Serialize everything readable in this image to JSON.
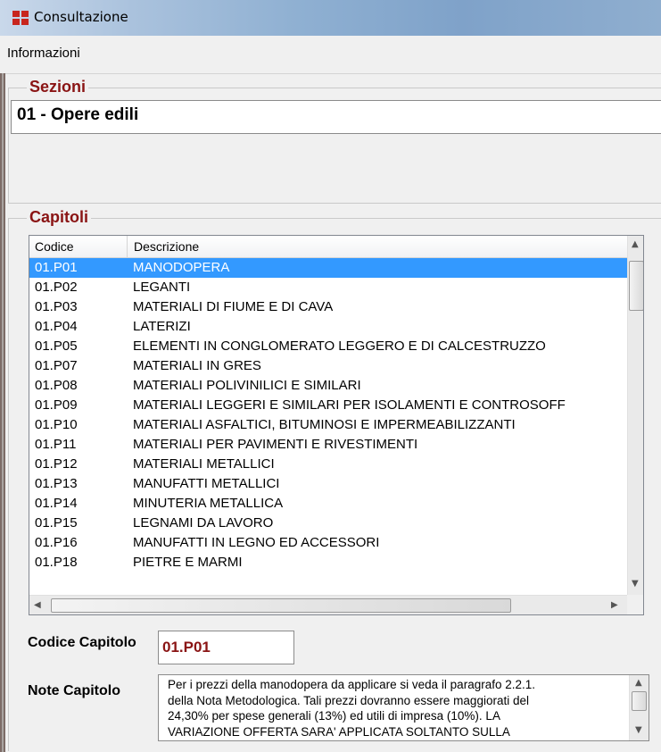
{
  "window": {
    "title": "Consultazione"
  },
  "menu": {
    "items": [
      "Informazioni"
    ]
  },
  "sezioni": {
    "label": "Sezioni",
    "value": "01 - Opere edili"
  },
  "capitoli": {
    "label": "Capitoli",
    "columns": [
      "Codice",
      "Descrizione"
    ],
    "rows": [
      {
        "code": "01.P01",
        "desc": "MANODOPERA",
        "selected": true
      },
      {
        "code": "01.P02",
        "desc": "LEGANTI"
      },
      {
        "code": "01.P03",
        "desc": "MATERIALI DI FIUME E DI CAVA"
      },
      {
        "code": "01.P04",
        "desc": "LATERIZI"
      },
      {
        "code": "01.P05",
        "desc": "ELEMENTI IN CONGLOMERATO LEGGERO E DI CALCESTRUZZO"
      },
      {
        "code": "01.P07",
        "desc": "MATERIALI IN GRES"
      },
      {
        "code": "01.P08",
        "desc": "MATERIALI POLIVINILICI E SIMILARI"
      },
      {
        "code": "01.P09",
        "desc": "MATERIALI LEGGERI E SIMILARI PER ISOLAMENTI E CONTROSOFF"
      },
      {
        "code": "01.P10",
        "desc": "MATERIALI ASFALTICI, BITUMINOSI E IMPERMEABILIZZANTI"
      },
      {
        "code": "01.P11",
        "desc": "MATERIALI PER PAVIMENTI E RIVESTIMENTI"
      },
      {
        "code": "01.P12",
        "desc": "MATERIALI METALLICI"
      },
      {
        "code": "01.P13",
        "desc": "MANUFATTI METALLICI"
      },
      {
        "code": "01.P14",
        "desc": "MINUTERIA METALLICA"
      },
      {
        "code": "01.P15",
        "desc": "LEGNAMI DA LAVORO"
      },
      {
        "code": "01.P16",
        "desc": "MANUFATTI IN LEGNO ED ACCESSORI"
      },
      {
        "code": "01.P18",
        "desc": "PIETRE E MARMI"
      }
    ]
  },
  "codice_capitolo": {
    "label": "Codice Capitolo",
    "value": "01.P01"
  },
  "note_capitolo": {
    "label": "Note Capitolo",
    "lines": [
      "Per i prezzi della manodopera da applicare si veda il paragrafo 2.2.1.",
      "della Nota Metodologica. Tali prezzi dovranno essere maggiorati del",
      "24,30% per spese generali (13%) ed utili di impresa (10%). LA",
      "VARIAZIONE OFFERTA SARA' APPLICATA SOLTANTO SULLA"
    ]
  },
  "colors": {
    "accent_label": "#8a1414",
    "selection": "#3399ff"
  },
  "icons": {
    "app": "app-grid-icon",
    "scroll_up": "scroll-up-arrow-icon",
    "scroll_down": "scroll-down-arrow-icon",
    "scroll_left": "scroll-left-arrow-icon",
    "scroll_right": "scroll-right-arrow-icon"
  }
}
